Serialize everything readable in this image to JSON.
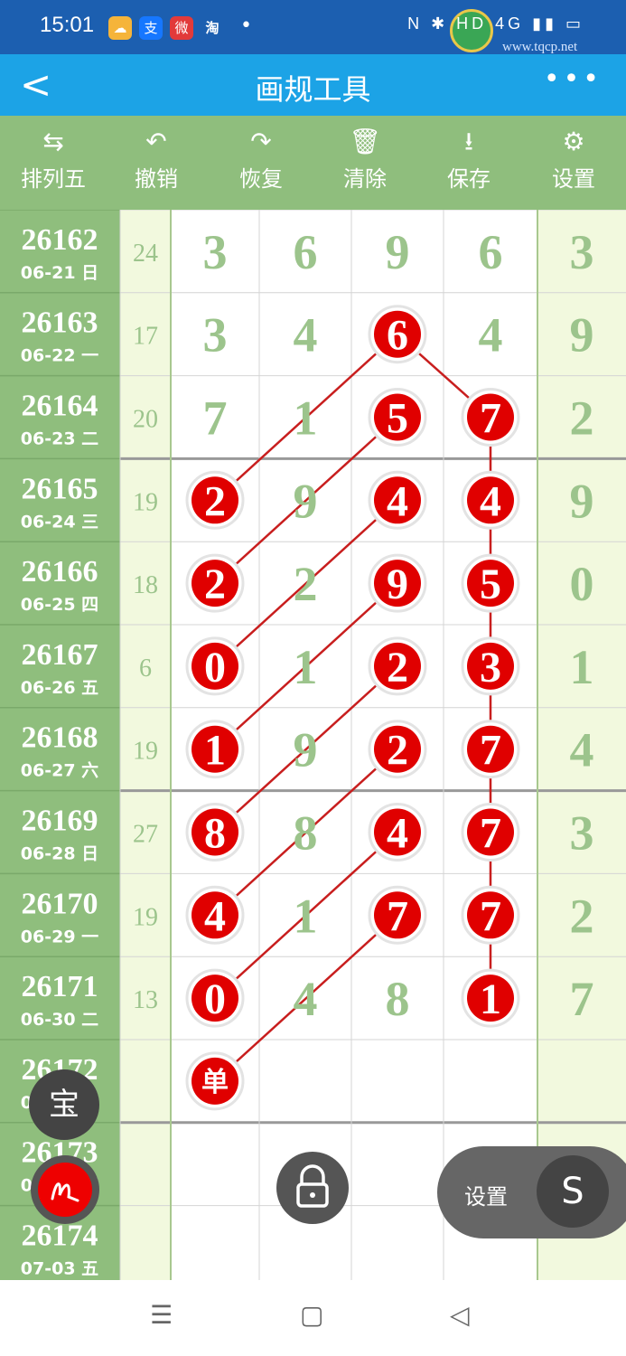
{
  "status_bar": {
    "time": "15:01",
    "apps": [
      "☁",
      "支",
      "微",
      "淘"
    ],
    "dot": "•",
    "right": "N ✱ HD 4G ▮▮ ▭",
    "watermark": "www.tqcp.net"
  },
  "title_bar": {
    "title": "画规工具",
    "back": "<",
    "more": "•••"
  },
  "toolbar": [
    {
      "icon": "⇆",
      "label": "排列五"
    },
    {
      "icon": "↶",
      "label": "撤销"
    },
    {
      "icon": "↷",
      "label": "恢复"
    },
    {
      "icon": "🗑",
      "label": "清除"
    },
    {
      "icon": "⭳",
      "label": "保存"
    },
    {
      "icon": "⚙",
      "label": "设置"
    }
  ],
  "rows": [
    {
      "issue": "26162",
      "date": "06-21 日",
      "sum": "24",
      "d": [
        "3",
        "6",
        "9",
        "6",
        "3"
      ]
    },
    {
      "issue": "26163",
      "date": "06-22 一",
      "sum": "17",
      "d": [
        "3",
        "4",
        "6",
        "4",
        "9"
      ]
    },
    {
      "issue": "26164",
      "date": "06-23 二",
      "sum": "20",
      "d": [
        "7",
        "1",
        "5",
        "7",
        "2"
      ]
    },
    {
      "issue": "26165",
      "date": "06-24 三",
      "sum": "19",
      "d": [
        "2",
        "9",
        "4",
        "4",
        "9"
      ]
    },
    {
      "issue": "26166",
      "date": "06-25 四",
      "sum": "18",
      "d": [
        "2",
        "2",
        "9",
        "5",
        "0"
      ]
    },
    {
      "issue": "26167",
      "date": "06-26 五",
      "sum": "6",
      "d": [
        "0",
        "1",
        "2",
        "3",
        "1"
      ]
    },
    {
      "issue": "26168",
      "date": "06-27 六",
      "sum": "19",
      "d": [
        "1",
        "9",
        "2",
        "7",
        "4"
      ]
    },
    {
      "issue": "26169",
      "date": "06-28 日",
      "sum": "27",
      "d": [
        "8",
        "8",
        "4",
        "7",
        "3"
      ]
    },
    {
      "issue": "26170",
      "date": "06-29 一",
      "sum": "19",
      "d": [
        "4",
        "1",
        "7",
        "7",
        "2"
      ]
    },
    {
      "issue": "26171",
      "date": "06-30 二",
      "sum": "13",
      "d": [
        "0",
        "4",
        "8",
        "1",
        "7"
      ]
    },
    {
      "issue": "26172",
      "date": "07-01 三",
      "sum": "",
      "d": [
        "单",
        "",
        "",
        "",
        ""
      ]
    },
    {
      "issue": "26173",
      "date": "07-02 四",
      "sum": "",
      "d": [
        "",
        "",
        "",
        "",
        ""
      ]
    },
    {
      "issue": "26174",
      "date": "07-03 五",
      "sum": "",
      "d": [
        "",
        "",
        "",
        "",
        ""
      ]
    }
  ],
  "circled": [
    [
      1,
      2
    ],
    [
      2,
      2
    ],
    [
      2,
      3
    ],
    [
      3,
      0
    ],
    [
      3,
      2
    ],
    [
      3,
      3
    ],
    [
      4,
      0
    ],
    [
      4,
      2
    ],
    [
      4,
      3
    ],
    [
      5,
      0
    ],
    [
      5,
      2
    ],
    [
      5,
      3
    ],
    [
      6,
      0
    ],
    [
      6,
      2
    ],
    [
      6,
      3
    ],
    [
      7,
      0
    ],
    [
      7,
      2
    ],
    [
      7,
      3
    ],
    [
      8,
      0
    ],
    [
      8,
      2
    ],
    [
      8,
      3
    ],
    [
      9,
      0
    ],
    [
      9,
      3
    ],
    [
      10,
      0
    ]
  ],
  "lines": [
    [
      1,
      2,
      3,
      0
    ],
    [
      1,
      2,
      2,
      3
    ],
    [
      2,
      2,
      4,
      0
    ],
    [
      2,
      3,
      3,
      3
    ],
    [
      3,
      2,
      5,
      0
    ],
    [
      3,
      3,
      4,
      3
    ],
    [
      4,
      2,
      6,
      0
    ],
    [
      4,
      3,
      5,
      3
    ],
    [
      5,
      2,
      7,
      0
    ],
    [
      5,
      3,
      6,
      3
    ],
    [
      6,
      2,
      8,
      0
    ],
    [
      6,
      3,
      7,
      3
    ],
    [
      7,
      2,
      9,
      0
    ],
    [
      7,
      3,
      8,
      3
    ],
    [
      8,
      2,
      10,
      0
    ],
    [
      8,
      3,
      9,
      3
    ]
  ],
  "floating": {
    "bao": "宝",
    "settings_label": "设置",
    "settings_icon": "S"
  },
  "nav": {
    "menu": "☰",
    "home": "▢",
    "back": "◁"
  },
  "colors": {
    "toolbar": "#8fbe7d",
    "title": "#1ca3e6",
    "issue_col": "#8fbe7d",
    "sum_col": "#f2f9de",
    "digit": "#9cc48c",
    "ball": "#e00000",
    "line": "#c81e1e"
  }
}
